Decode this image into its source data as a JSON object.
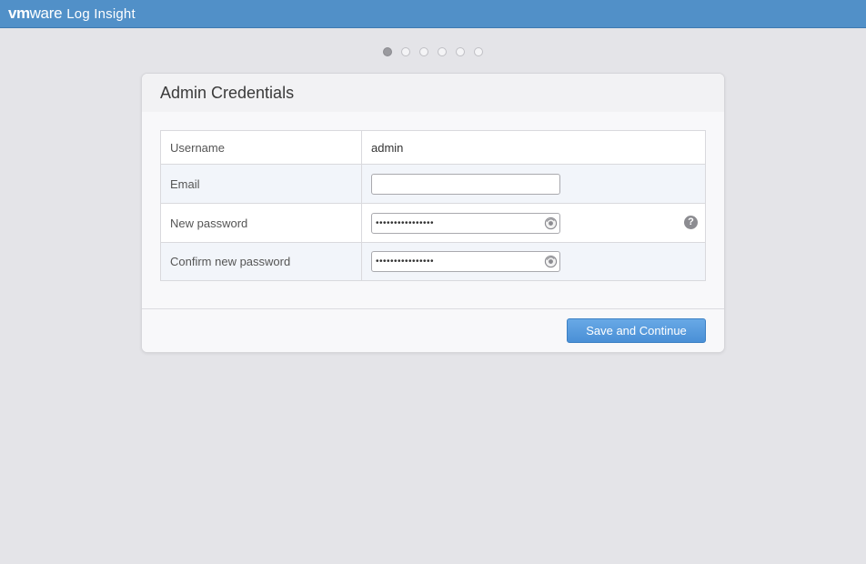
{
  "header": {
    "brand_vm": "vm",
    "brand_ware": "ware",
    "product": "Log Insight",
    "bg_color": "#5190c8"
  },
  "wizard": {
    "total_steps": 6,
    "current_step": 1
  },
  "card": {
    "title": "Admin Credentials",
    "fields": {
      "username": {
        "label": "Username",
        "value": "admin"
      },
      "email": {
        "label": "Email",
        "value": "",
        "placeholder": ""
      },
      "new_password": {
        "label": "New password",
        "masked": "••••••••••••••••",
        "help_icon": "?"
      },
      "confirm_password": {
        "label": "Confirm new password",
        "masked": "••••••••••••••••"
      }
    },
    "save_label": "Save and Continue",
    "accent_color": "#4a90d6"
  }
}
